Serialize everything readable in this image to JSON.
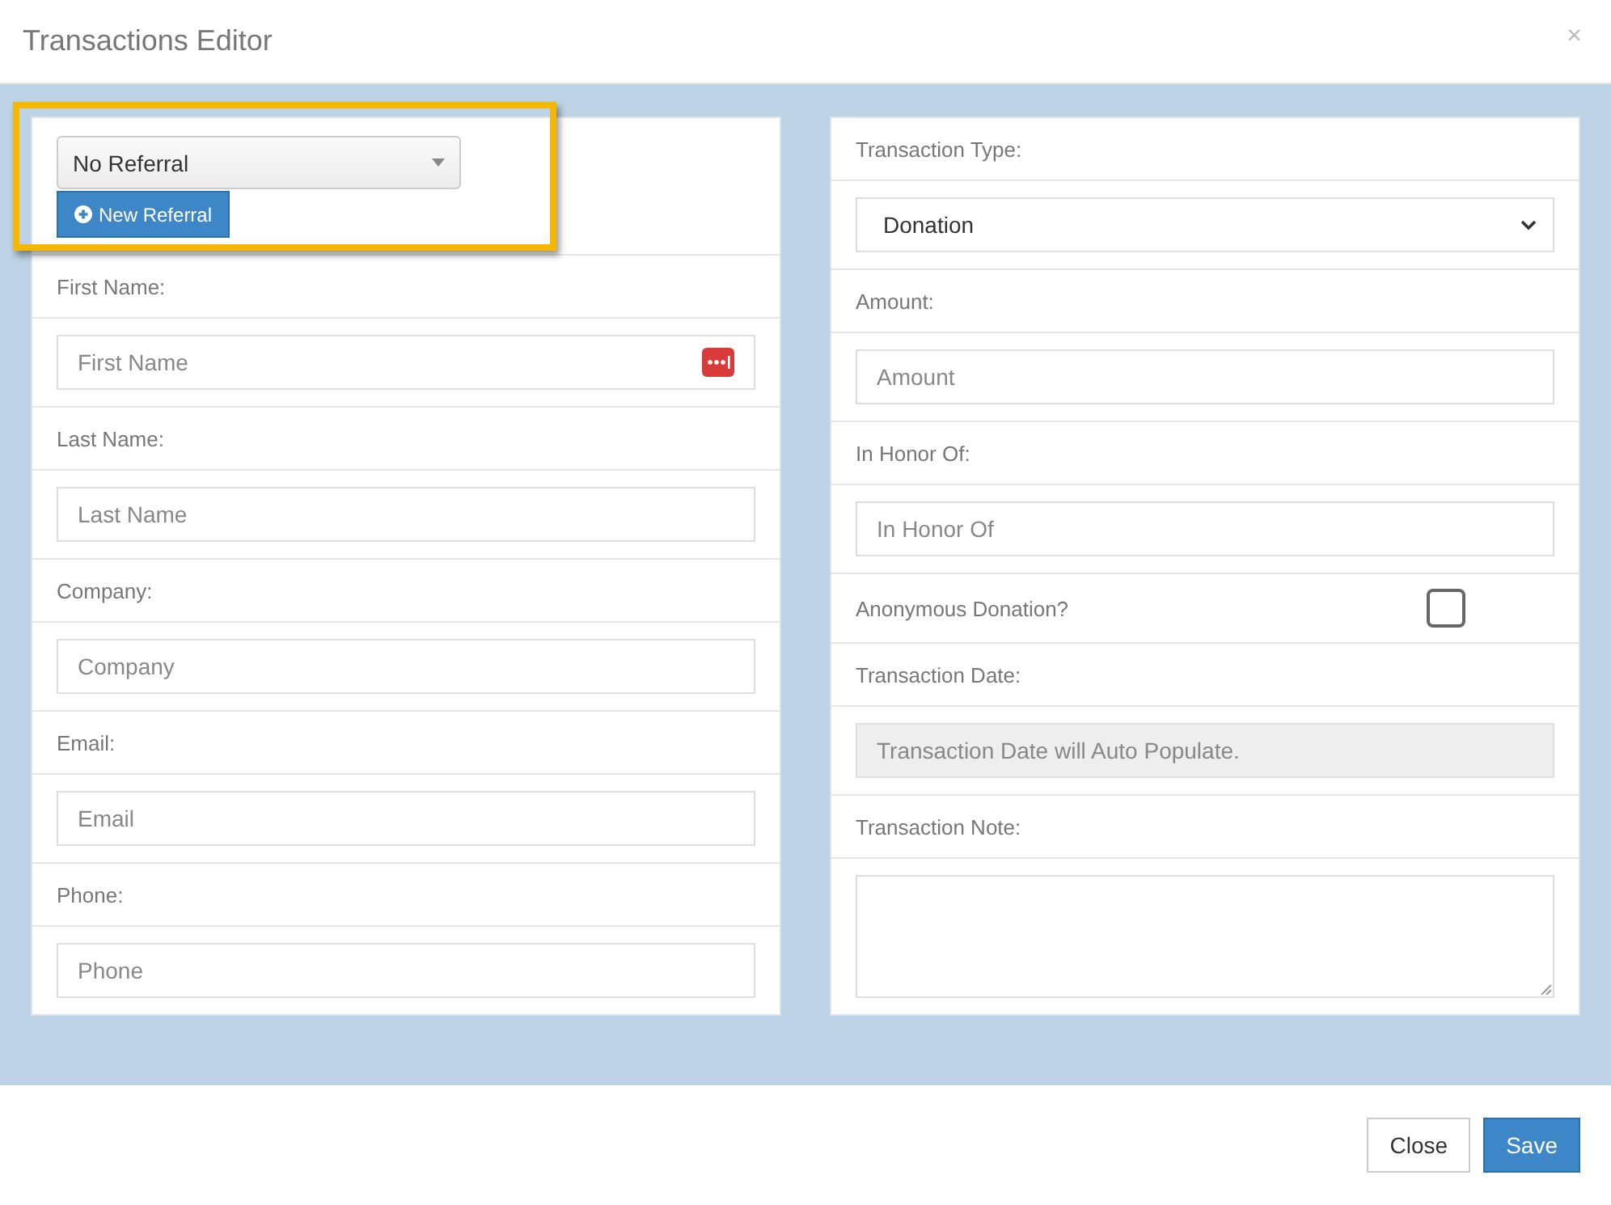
{
  "window": {
    "title": "Transactions Editor",
    "close": "×"
  },
  "referral": {
    "value": "No Referral",
    "button": "New Referral",
    "highlighted": true
  },
  "left_fields": [
    {
      "label": "First Name:",
      "placeholder": "First Name",
      "password_manager": true
    },
    {
      "label": "Last Name:",
      "placeholder": "Last Name",
      "password_manager": false
    },
    {
      "label": "Company:",
      "placeholder": "Company",
      "password_manager": false
    },
    {
      "label": "Email:",
      "placeholder": "Email",
      "password_manager": false
    },
    {
      "label": "Phone:",
      "placeholder": "Phone",
      "password_manager": false
    }
  ],
  "right_fields": [
    {
      "kind": "select",
      "label": "Transaction Type:",
      "value": "Donation"
    },
    {
      "kind": "text",
      "label": "Amount:",
      "placeholder": "Amount"
    },
    {
      "kind": "text",
      "label": "In Honor Of:",
      "placeholder": "In Honor Of"
    },
    {
      "kind": "checkbox",
      "label": "Anonymous Donation?",
      "checked": false
    },
    {
      "kind": "readonly",
      "label": "Transaction Date:",
      "placeholder": "Transaction Date will Auto Populate."
    },
    {
      "kind": "textarea",
      "label": "Transaction Note:"
    }
  ],
  "buttons": [
    {
      "label": "Close",
      "kind": "default"
    },
    {
      "label": "Save",
      "kind": "primary"
    }
  ]
}
